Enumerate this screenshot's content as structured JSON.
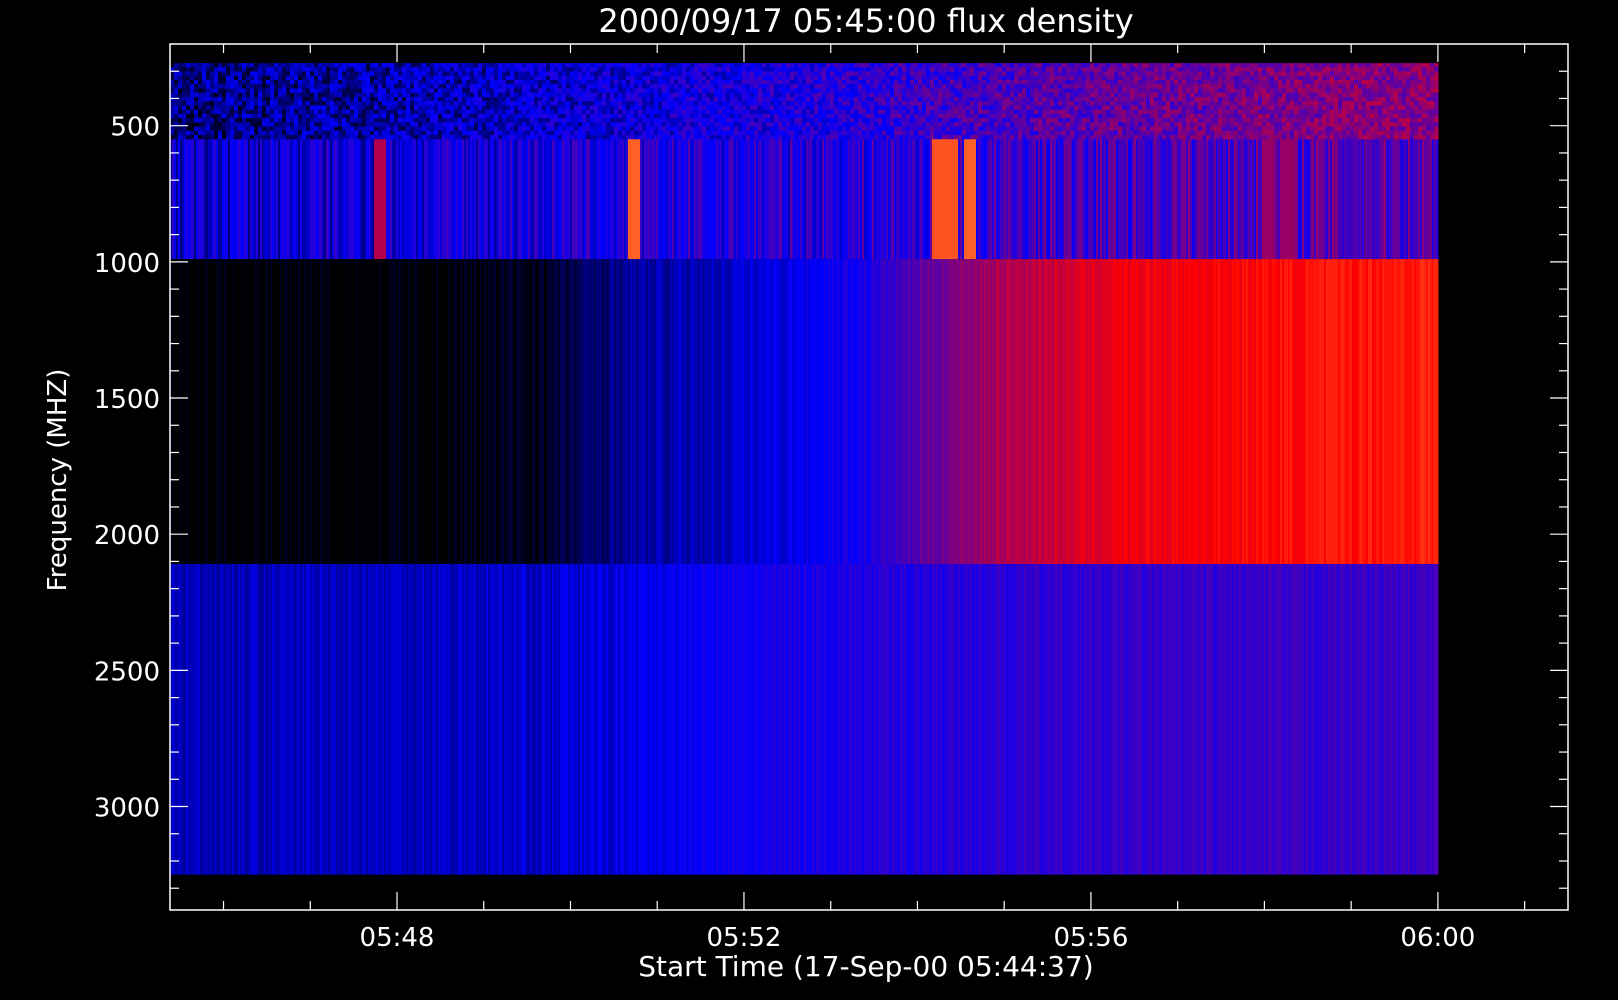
{
  "chart_data": {
    "type": "heatmap",
    "title": "2000/09/17 05:45:00 flux density",
    "xlabel": "Start Time (17-Sep-00 05:44:37)",
    "ylabel": "Frequency (MHZ)",
    "x_range_minutes": [
      5.383,
      21.5
    ],
    "y_range_mhz": [
      200,
      3380
    ],
    "y_inverted": true,
    "x_ticks": [
      {
        "label": "05:48",
        "minute": 8
      },
      {
        "label": "05:52",
        "minute": 12
      },
      {
        "label": "05:56",
        "minute": 16
      },
      {
        "label": "06:00",
        "minute": 20
      }
    ],
    "y_ticks": [
      {
        "label": "500",
        "value": 500
      },
      {
        "label": "1000",
        "value": 1000
      },
      {
        "label": "1500",
        "value": 1500
      },
      {
        "label": "2000",
        "value": 2000
      },
      {
        "label": "2500",
        "value": 2500
      },
      {
        "label": "3000",
        "value": 3000
      }
    ],
    "data_time_range": [
      5.383,
      20.0
    ],
    "bands": [
      {
        "name": "band-270-550",
        "f_lo": 270,
        "f_hi": 550,
        "mode": "noise",
        "profile": [
          [
            0,
            0.12
          ],
          [
            0.25,
            0.2
          ],
          [
            0.5,
            0.3
          ],
          [
            0.7,
            0.42
          ],
          [
            0.85,
            0.48
          ],
          [
            1,
            0.52
          ]
        ]
      },
      {
        "name": "band-550-990",
        "f_lo": 550,
        "f_hi": 990,
        "mode": "striped",
        "profile": [
          [
            0,
            0.22
          ],
          [
            0.3,
            0.28
          ],
          [
            0.6,
            0.33
          ],
          [
            0.8,
            0.4
          ],
          [
            1,
            0.42
          ]
        ],
        "bursts": [
          [
            0.16,
            0.17,
            0.6
          ],
          [
            0.36,
            0.37,
            0.9
          ],
          [
            0.6,
            0.62,
            0.88
          ],
          [
            0.625,
            0.635,
            0.9
          ],
          [
            0.86,
            0.87,
            0.55
          ],
          [
            0.875,
            0.885,
            0.55
          ]
        ]
      },
      {
        "name": "band-990-2110",
        "f_lo": 990,
        "f_hi": 2110,
        "mode": "smooth",
        "profile": [
          [
            0,
            0.0
          ],
          [
            0.2,
            0.0
          ],
          [
            0.3,
            0.04
          ],
          [
            0.35,
            0.14
          ],
          [
            0.45,
            0.2
          ],
          [
            0.55,
            0.3
          ],
          [
            0.6,
            0.45
          ],
          [
            0.65,
            0.58
          ],
          [
            0.75,
            0.72
          ],
          [
            1,
            0.8
          ]
        ]
      },
      {
        "name": "band-2110-3250",
        "f_lo": 2110,
        "f_hi": 3250,
        "mode": "smooth",
        "profile": [
          [
            0,
            0.18
          ],
          [
            0.3,
            0.2
          ],
          [
            0.5,
            0.3
          ],
          [
            0.7,
            0.34
          ],
          [
            1,
            0.36
          ]
        ]
      }
    ],
    "colormap": [
      "#000000",
      "#0000ff",
      "#800080",
      "#ff0000",
      "#ffa040"
    ],
    "background": "#000000",
    "foreground": "#ffffff"
  }
}
